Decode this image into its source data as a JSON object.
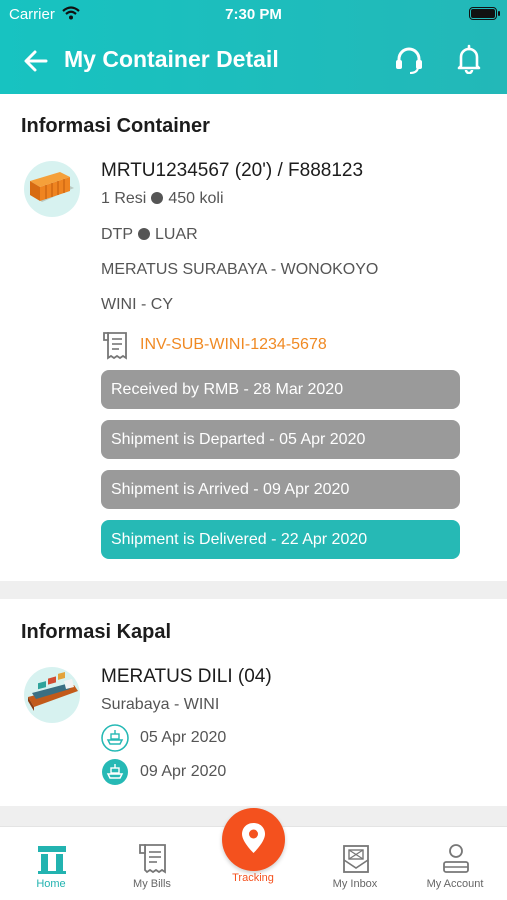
{
  "status_bar": {
    "carrier": "Carrier",
    "time": "7:30 PM"
  },
  "nav": {
    "title": "My Container Detail"
  },
  "container_section": {
    "title": "Informasi Container",
    "container_id": "MRTU1234567 (20') / F888123",
    "resi": "1 Resi",
    "koli": "450 koli",
    "type": "DTP",
    "location": "LUAR",
    "route": "MERATUS SURABAYA - WONOKOYO",
    "terminal": "WINI - CY",
    "invoice": "INV-SUB-WINI-1234-5678",
    "statuses": [
      {
        "label": "Received by RMB - 28 Mar 2020",
        "active": false
      },
      {
        "label": "Shipment is Departed - 05 Apr 2020",
        "active": false
      },
      {
        "label": "Shipment is Arrived - 09 Apr 2020",
        "active": false
      },
      {
        "label": "Shipment is Delivered - 22 Apr 2020",
        "active": true
      }
    ]
  },
  "ship_section": {
    "title": "Informasi Kapal",
    "ship_name": "MERATUS DILI (04)",
    "route": "Surabaya - WINI",
    "departure_date": "05 Apr 2020",
    "arrival_date": "09 Apr 2020"
  },
  "tabbar": {
    "home": "Home",
    "bills": "My Bills",
    "tracking": "Tracking",
    "inbox": "My Inbox",
    "account": "My Account"
  },
  "colors": {
    "brand_teal": "#23b8b8",
    "status_inactive": "#9a9a9a",
    "status_active": "#26b9b5",
    "invoice_orange": "#f08a24",
    "tracking_orange": "#f4511e"
  }
}
